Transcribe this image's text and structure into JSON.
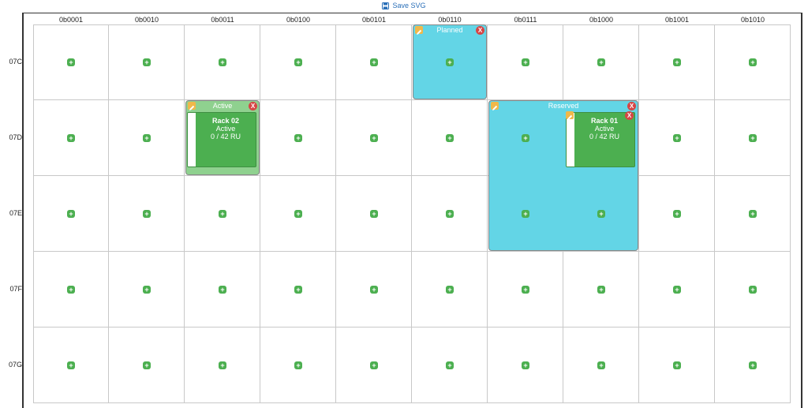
{
  "toolbar": {
    "save_label": "Save SVG",
    "save_icon": "floppy-disk-icon"
  },
  "columns": [
    "0b0001",
    "0b0010",
    "0b0011",
    "0b0100",
    "0b0101",
    "0b0110",
    "0b0111",
    "0b1000",
    "0b1001",
    "0b1010"
  ],
  "rows": [
    "07C",
    "07D",
    "07E",
    "07F",
    "07G"
  ],
  "blocks": [
    {
      "title": "Planned",
      "color": "#63d5e6",
      "status": "planned"
    },
    {
      "title": "Active",
      "color": "#8fd18f",
      "status": "active"
    },
    {
      "title": "Reserved",
      "color": "#63d5e6",
      "status": "reserved"
    }
  ],
  "racks": [
    {
      "name": "Rack 02",
      "status": "Active",
      "capacity": "0 / 42 RU"
    },
    {
      "name": "Rack 01",
      "status": "Active",
      "capacity": "0 / 42 RU"
    }
  ],
  "controls": {
    "add_glyph": "+",
    "remove_glyph": "X"
  },
  "colors": {
    "accent": "#4caf50",
    "link": "#2a6fb8",
    "remove": "#d64545",
    "edit": "#f0b84a"
  }
}
